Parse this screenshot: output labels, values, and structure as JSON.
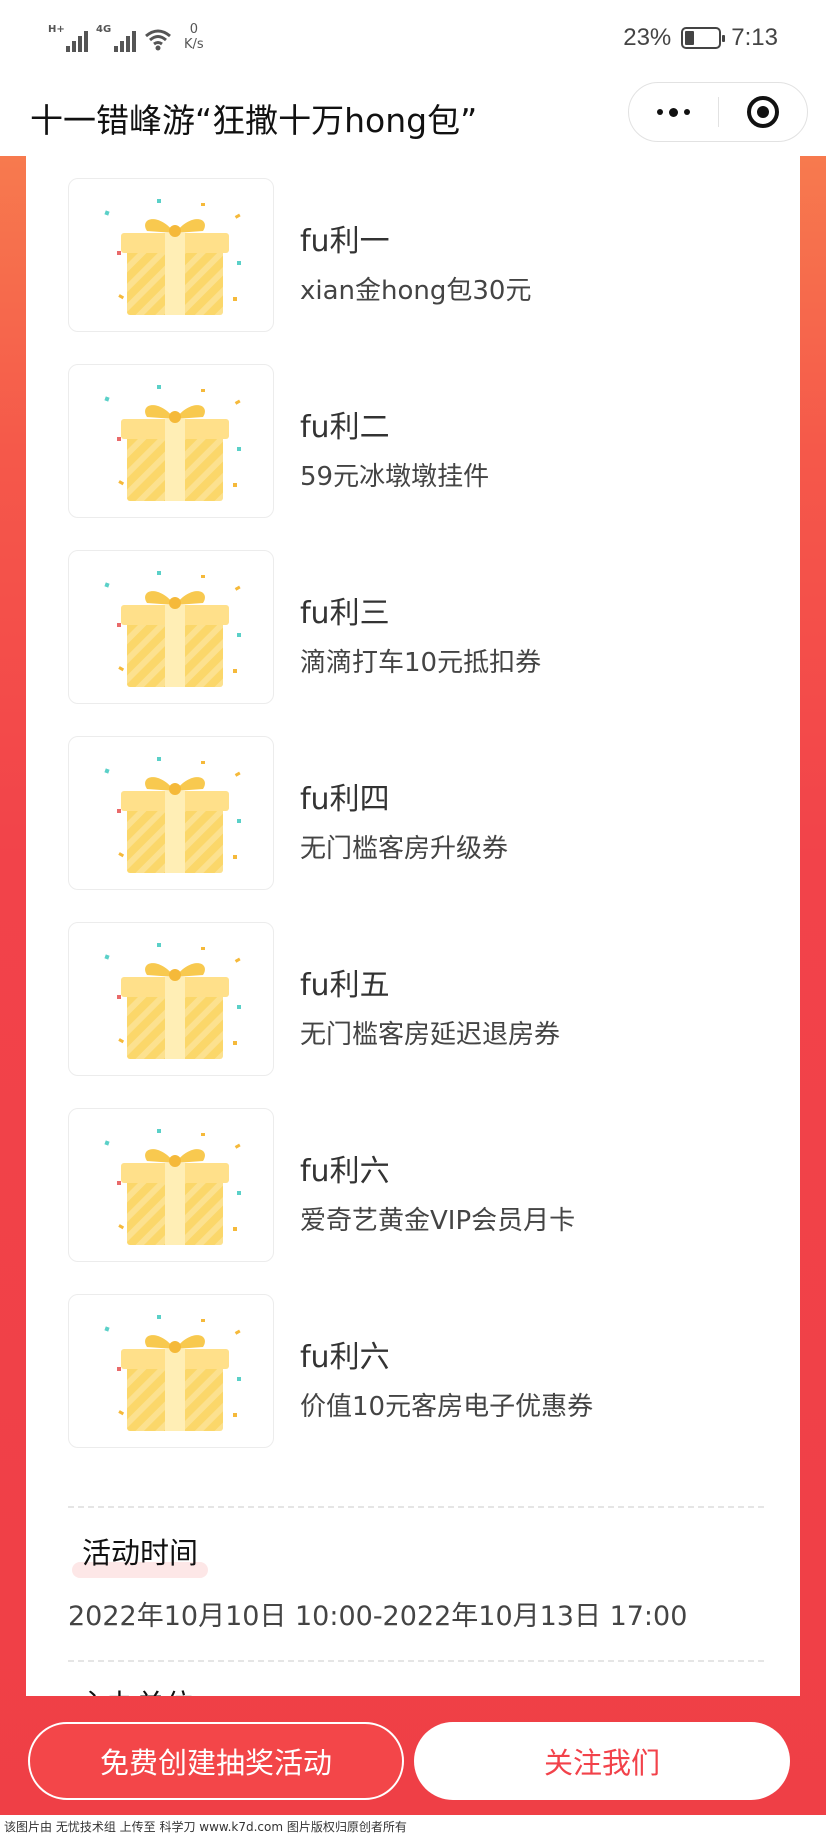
{
  "status_bar": {
    "signal1_tag": "H+",
    "signal2_tag": "4G",
    "net_speed_value": "0",
    "net_speed_unit": "K/s",
    "battery": "23%",
    "time": "7:13"
  },
  "title_bar": {
    "title": "十一错峰游“狂撒十万hong包”",
    "more_icon": "more-dots-icon",
    "close_icon": "target-circle-icon"
  },
  "prizes": [
    {
      "name": "fu利一",
      "desc": "xian金hong包30元",
      "icon": "gift-box-icon"
    },
    {
      "name": "fu利二",
      "desc": "59元冰墩墩挂件",
      "icon": "gift-box-icon"
    },
    {
      "name": "fu利三",
      "desc": "滴滴打车10元抵扣券",
      "icon": "gift-box-icon"
    },
    {
      "name": "fu利四",
      "desc": "无门槛客房升级券",
      "icon": "gift-box-icon"
    },
    {
      "name": "fu利五",
      "desc": "无门槛客房延迟退房券",
      "icon": "gift-box-icon"
    },
    {
      "name": "fu利六",
      "desc": "爱奇艺黄金VIP会员月卡",
      "icon": "gift-box-icon"
    },
    {
      "name": "fu利六",
      "desc": "价值10元客房电子优惠券",
      "icon": "gift-box-icon"
    }
  ],
  "activity": {
    "time_label": "活动时间",
    "time_value": "2022年10月10日 10:00-2022年10月13日 17:00",
    "host_label": "主办单位"
  },
  "buttons": {
    "create": "免费创建抽奖活动",
    "follow": "关注我们"
  },
  "footer": "该图片由 无忧技术组 上传至 科学刀 www.k7d.com 图片版权归原创者所有",
  "colors": {
    "brand_red": "#f34649",
    "gift_gold": "#f8c94f"
  }
}
